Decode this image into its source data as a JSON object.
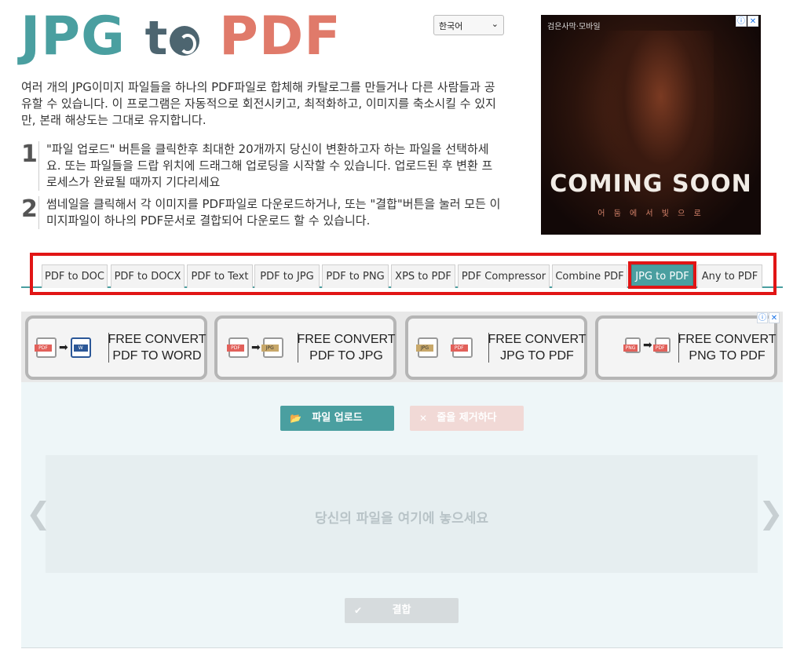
{
  "logo": {
    "part1": "JPG",
    "part2": "t",
    "part3": "PDF"
  },
  "language": {
    "selected": "한국어"
  },
  "intro": "여러 개의 JPG이미지 파일들을 하나의 PDF파일로 합체해 카탈로그를 만들거나 다른 사람들과 공유할 수 있습니다. 이 프로그램은 자동적으로 회전시키고, 최적화하고, 이미지를 축소시킬 수 있지만, 본래 해상도는 그대로 유지합니다.",
  "steps": [
    {
      "number": "1",
      "text": "\"파일 업로드\" 버튼을 클릭한후 최대한 20개까지 당신이 변환하고자 하는 파일을 선택하세요. 또는 파일들을 드랍 위치에 드래그해 업로딩을 시작할 수 있습니다. 업로드된 후 변환 프로세스가 완료될 때까지 기다리세요"
    },
    {
      "number": "2",
      "text": "썸네일을 클릭해서 각 이미지를 PDF파일로 다운로드하거나, 또는 \"결합\"버튼을 눌러 모든 이미지파일이 하나의 PDF문서로 결합되어 다운로드 할 수 있습니다."
    }
  ],
  "ad_movie": {
    "small_text": "검은사막·모바일",
    "headline": "COMING SOON",
    "subline": "어 둠 에 서  빛 으 로",
    "info_icon": "ⓘ",
    "close_icon": "✕"
  },
  "tabs": [
    {
      "label": "PDF to DOC"
    },
    {
      "label": "PDF to DOCX"
    },
    {
      "label": "PDF to Text"
    },
    {
      "label": "PDF to JPG"
    },
    {
      "label": "PDF to PNG"
    },
    {
      "label": "XPS to PDF"
    },
    {
      "label": "PDF Compressor"
    },
    {
      "label": "Combine PDF"
    },
    {
      "label": "JPG to PDF",
      "active": true
    },
    {
      "label": "Any to PDF"
    }
  ],
  "ad_strip": {
    "info_icon": "ⓘ",
    "close_icon": "✕",
    "cards": [
      {
        "line1": "FREE CONVERT",
        "line2": "PDF TO WORD",
        "from": "PDF",
        "to": "W"
      },
      {
        "line1": "FREE CONVERT",
        "line2": "PDF TO JPG",
        "from": "PDF",
        "to": "JPG"
      },
      {
        "line1": "FREE CONVERT",
        "line2": "JPG TO PDF",
        "from": "JPG",
        "to": "PDF"
      },
      {
        "line1": "FREE CONVERT",
        "line2": "PNG TO PDF",
        "from": "PNG",
        "to": "PDF"
      }
    ]
  },
  "upload": {
    "upload_label": "파일 업로드",
    "clear_label": "줄을 제거하다",
    "drop_text": "당신의 파일을 여기에 놓으세요",
    "combine_label": "결합",
    "prev_arrow": "❮",
    "next_arrow": "❯"
  },
  "colors": {
    "teal": "#4a9fa0",
    "coral": "#e07a6a",
    "slate": "#4d6570",
    "highlight": "#e11515"
  }
}
